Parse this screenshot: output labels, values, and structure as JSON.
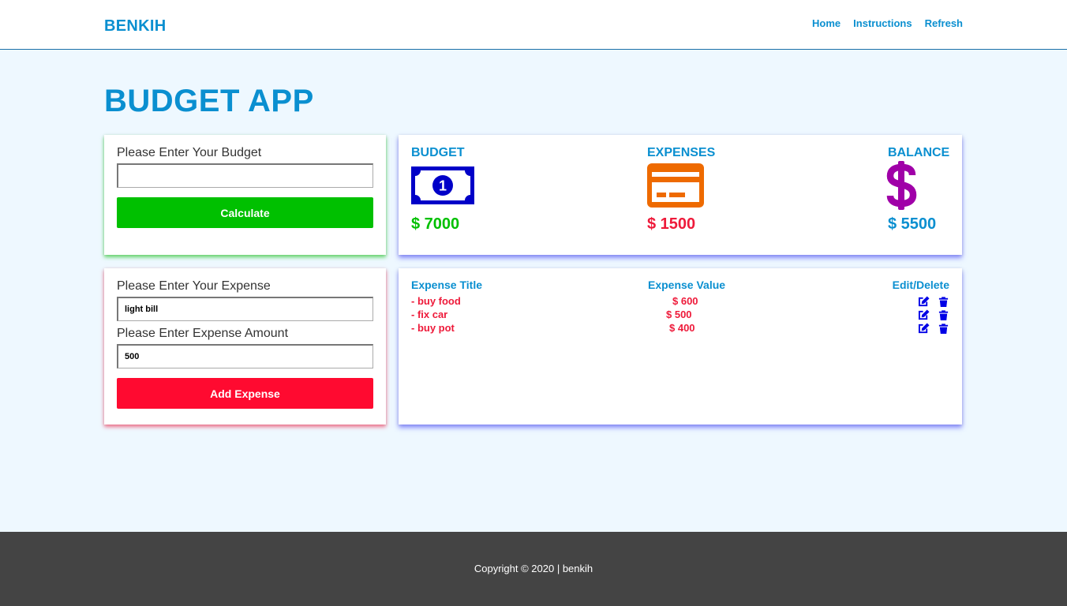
{
  "nav": {
    "brand": "BENKIH",
    "links": [
      "Home",
      "Instructions",
      "Refresh"
    ]
  },
  "page": {
    "title": "BUDGET APP"
  },
  "budget_form": {
    "label": "Please Enter Your Budget",
    "value": "",
    "button": "Calculate"
  },
  "expense_form": {
    "title_label": "Please Enter Your Expense",
    "title_value": "light bill",
    "amount_label": "Please Enter Expense Amount",
    "amount_value": "500",
    "button": "Add Expense"
  },
  "summary": {
    "budget_label": "BUDGET",
    "budget_value": "$ 7000",
    "expenses_label": "EXPENSES",
    "expenses_value": "$ 1500",
    "balance_label": "BALANCE",
    "balance_value": "$ 5500",
    "icons": [
      "money-bill-icon",
      "credit-card-icon",
      "dollar-sign-icon"
    ]
  },
  "expense_list": {
    "headers": [
      "Expense Title",
      "Expense Value",
      "Edit/Delete"
    ],
    "rows": [
      {
        "title": "- buy food",
        "value": "$ 600"
      },
      {
        "title": "- fix car",
        "value": "$ 500"
      },
      {
        "title": "- buy pot",
        "value": "$ 400"
      }
    ]
  },
  "footer": {
    "text": "Copyright © 2020 | benkih"
  },
  "colors": {
    "primary": "#0a8fd0",
    "success": "#00c000",
    "danger": "#ff0a30",
    "budget_icon": "#0000c8",
    "expense_icon": "#ee6a00",
    "balance_icon": "#a000a8",
    "action_icon": "#0000e6"
  }
}
